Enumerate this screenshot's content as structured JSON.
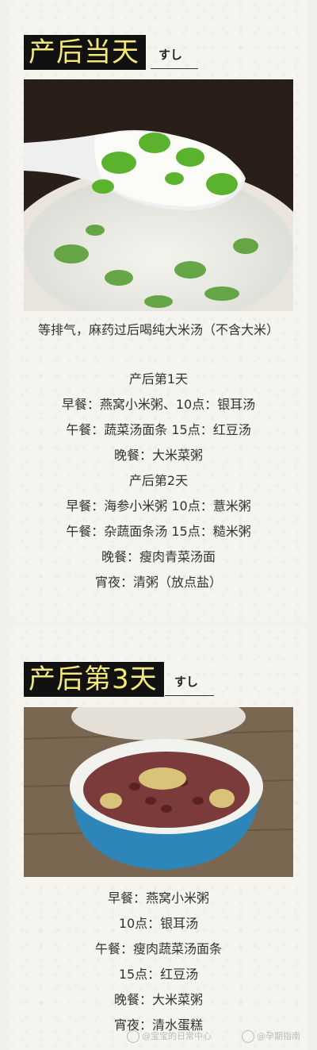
{
  "section1": {
    "title": "产后当天",
    "suffix": "すし",
    "lines": [
      "等排气，麻药过后喝纯大米汤（不含大米）",
      "产后第1天",
      "早餐：燕窝小米粥、10点：银耳汤",
      "午餐：蔬菜汤面条 15点：红豆汤",
      "晚餐：大米菜粥",
      "产后第2天",
      "早餐：海参小米粥 10点：薏米粥",
      "午餐：杂蔬面条汤 15点：糙米粥",
      "晚餐：瘦肉青菜汤面",
      "宵夜：清粥（放点盐）"
    ]
  },
  "section2": {
    "title": "产后第3天",
    "suffix": "すし",
    "lines": [
      "早餐：燕窝小米粥",
      "10点：银耳汤",
      "午餐：瘦肉蔬菜汤面条",
      "15点：红豆汤",
      "晚餐：大米菜粥",
      "宵夜：清水蛋糕"
    ]
  },
  "watermark": {
    "left": "@宝宝的日常中心",
    "right": "@孕期指南"
  }
}
